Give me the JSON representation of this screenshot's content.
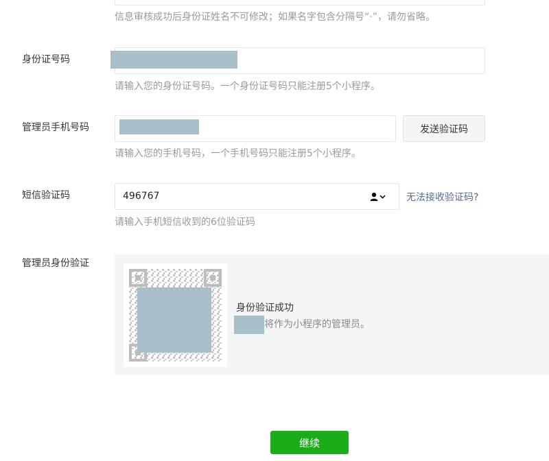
{
  "name_field": {
    "hint": "信息审核成功后身份证姓名不可修改；如果名字包含分隔号“·”，请勿省略。"
  },
  "id_field": {
    "label": "身份证号码",
    "hint": "请输入您的身份证号码。一个身份证号码只能注册5个小程序。"
  },
  "phone_field": {
    "label": "管理员手机号码",
    "send_button": "发送验证码",
    "hint": "请输入您的手机号码，一个手机号码只能注册5个小程序。"
  },
  "sms_field": {
    "label": "短信验证码",
    "value": "496767",
    "help_link": "无法接收验证码?",
    "hint": "请输入手机短信收到的6位验证码"
  },
  "admin_verify": {
    "label": "管理员身份验证",
    "success_title": "身份验证成功",
    "success_desc": "将作为小程序的管理员。"
  },
  "continue_button": "继续"
}
